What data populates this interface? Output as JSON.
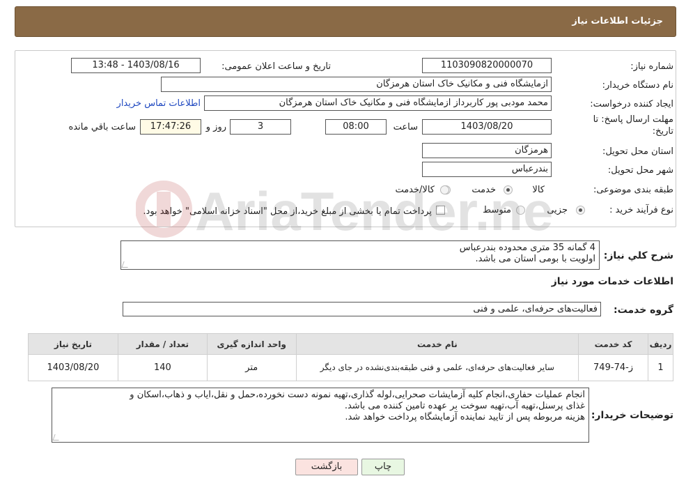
{
  "header": {
    "title": "جزئیات اطلاعات نیاز"
  },
  "fields": {
    "need_number_label": "شماره نیاز:",
    "need_number": "1103090820000070",
    "announce_label": "تاریخ و ساعت اعلان عمومی:",
    "announce_value": "1403/08/16 - 13:48",
    "buyer_org_label": "نام دستگاه خریدار:",
    "buyer_org": "ازمایشگاه فنی و مکانیک خاک استان هرمزگان",
    "requester_label": "ایجاد کننده درخواست:",
    "requester": "محمد  مودبی پور کاربرداز ازمایشگاه فنی و مکانیک خاک استان هرمزگان",
    "contact_link": "اطلاعات تماس خریدار",
    "deadline_label_line1": "مهلت ارسال پاسخ: تا",
    "deadline_label_line2": "تاریخ:",
    "deadline_date": "1403/08/20",
    "time_label": "ساعت",
    "deadline_time": "08:00",
    "days_value": "3",
    "days_label": "روز و",
    "remaining_time": "17:47:26",
    "remaining_label": "ساعت باقي مانده",
    "province_label": "استان محل تحویل:",
    "province": "هرمزگان",
    "city_label": "شهر محل تحویل:",
    "city": "بندرعباس",
    "category_label": "طبقه بندی موضوعی:",
    "category_options": [
      "کالا",
      "خدمت",
      "کالا/خدمت"
    ],
    "category_selected": "کالا",
    "purchase_type_label": "نوع فرآیند خرید :",
    "purchase_options": [
      "جزیی",
      "متوسط"
    ],
    "purchase_selected": "جزیی",
    "payment_note": "پرداخت تمام یا بخشی از مبلغ خرید،از محل \"اسناد خزانه اسلامی\" خواهد بود."
  },
  "summary": {
    "label": "شرح کلي نياز:",
    "lines": [
      "4 گمانه 35 متری محدوده بندرعباس",
      "اولویت با بومی استان می باشد."
    ]
  },
  "services_section": {
    "title": "اطلاعات خدمات مورد نیاز",
    "group_label": "گروه خدمت:",
    "group_value": "فعالیت‌های حرفه‌ای، علمی و فنی"
  },
  "table": {
    "headers": [
      "ردیف",
      "کد خدمت",
      "نام خدمت",
      "واحد اندازه گیری",
      "تعداد / مقدار",
      "تاریخ نیاز"
    ],
    "rows": [
      [
        "1",
        "ز-74-749",
        "سایر فعالیت‌های حرفه‌ای، علمی و فنی طبقه‌بندی‌نشده در جای دیگر",
        "متر",
        "140",
        "1403/08/20"
      ]
    ]
  },
  "buyer_notes": {
    "label": "توضیحات خریدار:",
    "lines": [
      "انجام عملیات حفاری،انجام کلیه آزمایشات صحرایی،لوله گذاری،تهیه نمونه دست نخورده،حمل و نقل،ایاب و ذهاب،اسکان و",
      "غذای پرسنل،تهیه آب،تهیه سوخت بر عهده تامین کننده می باشد.",
      "هزینه مربوطه پس از تایید نماینده آزمایشگاه پرداخت خواهد شد."
    ]
  },
  "buttons": {
    "print": "چاپ",
    "back": "بازگشت"
  },
  "watermark": {
    "text": "AriaTender.neT"
  },
  "colors": {
    "header": "#8a6a46",
    "print_button": "#e8f7e2",
    "back_button": "#fbe3e0",
    "link": "#1f48c0"
  }
}
